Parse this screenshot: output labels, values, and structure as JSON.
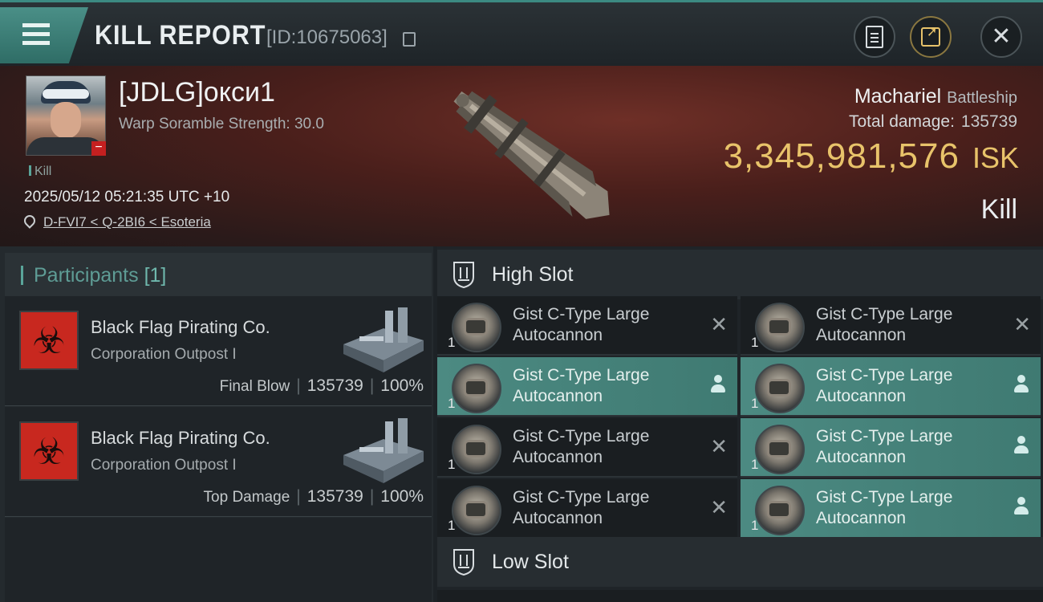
{
  "header": {
    "title": "KILL REPORT",
    "report_id": "[ID:10675063]"
  },
  "victim": {
    "pilot_name": "[JDLG]окси1",
    "scramble": "Warp Soramble Strength: 30.0",
    "kill_tag": "Kill",
    "datetime": "2025/05/12 05:21:35 UTC +10",
    "location": "D-FVI7 < Q-2BI6 < Esoteria",
    "ship_name": "Machariel",
    "ship_class": "Battleship",
    "total_damage_label": "Total damage:",
    "total_damage": "135739",
    "isk_value": "3,345,981,576",
    "isk_unit": "ISK",
    "result": "Kill"
  },
  "participants": {
    "label": "Participants",
    "count": "[1]",
    "rows": [
      {
        "name": "Black Flag Pirating Co.",
        "corp": "Corporation Outpost I",
        "role": "Final Blow",
        "damage": "135739",
        "percent": "100%"
      },
      {
        "name": "Black Flag Pirating Co.",
        "corp": "Corporation Outpost I",
        "role": "Top Damage",
        "damage": "135739",
        "percent": "100%"
      }
    ]
  },
  "slots": {
    "high_label": "High Slot",
    "low_label": "Low Slot",
    "items": [
      {
        "line1": "Gist C-Type Large",
        "line2": "Autocannon",
        "qty": "1",
        "status": "destroyed"
      },
      {
        "line1": "Gist C-Type Large",
        "line2": "Autocannon",
        "qty": "1",
        "status": "destroyed"
      },
      {
        "line1": "Gist C-Type Large",
        "line2": "Autocannon",
        "qty": "1",
        "status": "dropped"
      },
      {
        "line1": "Gist C-Type Large",
        "line2": "Autocannon",
        "qty": "1",
        "status": "dropped"
      },
      {
        "line1": "Gist C-Type Large",
        "line2": "Autocannon",
        "qty": "1",
        "status": "destroyed"
      },
      {
        "line1": "Gist C-Type Large",
        "line2": "Autocannon",
        "qty": "1",
        "status": "dropped"
      },
      {
        "line1": "Gist C-Type Large",
        "line2": "Autocannon",
        "qty": "1",
        "status": "destroyed"
      },
      {
        "line1": "Gist C-Type Large",
        "line2": "Autocannon",
        "qty": "1",
        "status": "dropped"
      }
    ]
  },
  "icons": {
    "menu": "hamburger-icon",
    "copy": "copy-icon",
    "clipboard": "clipboard-icon",
    "share": "share-icon",
    "close": "close-icon",
    "pin": "location-pin-icon",
    "slot": "shield-slot-icon",
    "destroyed": "close-x-icon",
    "dropped": "person-icon"
  },
  "colors": {
    "accent": "#4c8a82",
    "isk": "#e8c36a",
    "corp_logo": "#c8281f"
  }
}
